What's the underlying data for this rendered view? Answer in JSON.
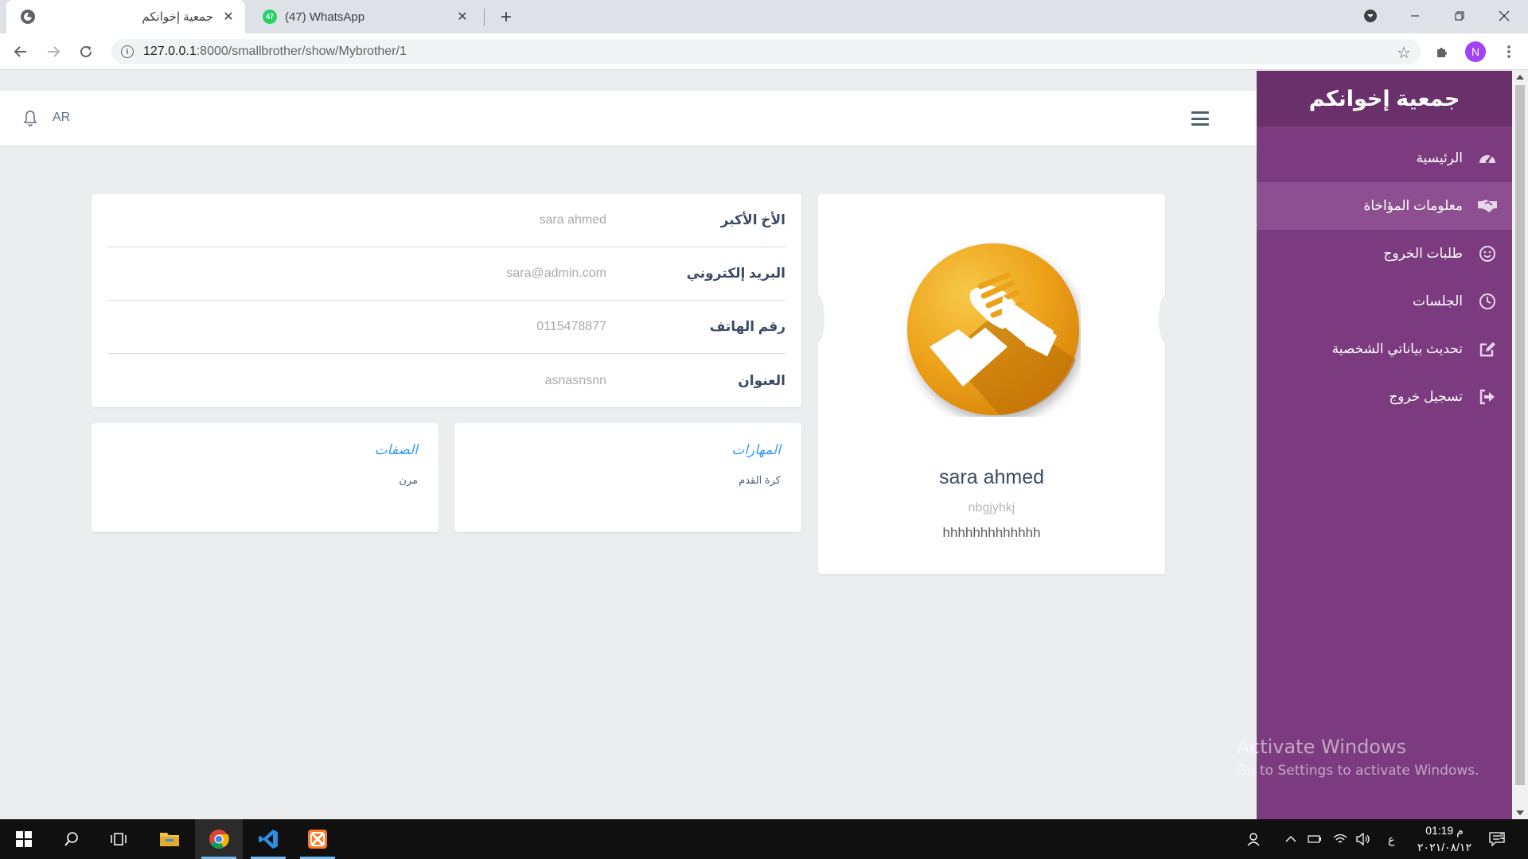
{
  "browser": {
    "tabs": [
      {
        "title": "جمعية إخوانكم",
        "active": true
      },
      {
        "title": "(47) WhatsApp",
        "badge": "47",
        "active": false
      }
    ],
    "url_host": "127.0.0.1",
    "url_path": ":8000/smallbrother/show/Mybrother/1",
    "profile_initial": "N"
  },
  "topnav": {
    "lang": "AR"
  },
  "sidebar": {
    "brand": "جمعية إخوانكم",
    "items": [
      {
        "label": "الرئيسية",
        "icon": "dashboard-icon",
        "active": false
      },
      {
        "label": "معلومات المؤاخاة",
        "icon": "handshake-icon",
        "active": true
      },
      {
        "label": "طلبات الخروج",
        "icon": "smile-icon",
        "active": false
      },
      {
        "label": "الجلسات",
        "icon": "clock-icon",
        "active": false
      },
      {
        "label": "تحديث بياناتي الشخصية",
        "icon": "edit-icon",
        "active": false
      },
      {
        "label": "تسجيل خروج",
        "icon": "logout-icon",
        "active": false
      }
    ],
    "accent": "#7b3b7e"
  },
  "info": {
    "rows": [
      {
        "label": "الأخ الأكبر",
        "value": "sara ahmed"
      },
      {
        "label": "البريد إلكتروني",
        "value": "sara@admin.com"
      },
      {
        "label": "رقم الهاتف",
        "value": "0115478877"
      },
      {
        "label": "العنوان",
        "value": "asnasnsnn"
      }
    ]
  },
  "skills": {
    "title": "المهارات",
    "text": "كرة القدم"
  },
  "traits": {
    "title": "الصفات",
    "text": "مرن"
  },
  "profile": {
    "name": "sara ahmed",
    "username": "nbgjyhkj",
    "bio": "hhhhhhhhhhhhh"
  },
  "watermark": {
    "title": "Activate Windows",
    "subtitle": "Go to Settings to activate Windows."
  },
  "taskbar": {
    "time": "01:19 م",
    "date": "٢٠٢١/٠٨/١٢",
    "lang": "ع",
    "notifications": "1"
  }
}
